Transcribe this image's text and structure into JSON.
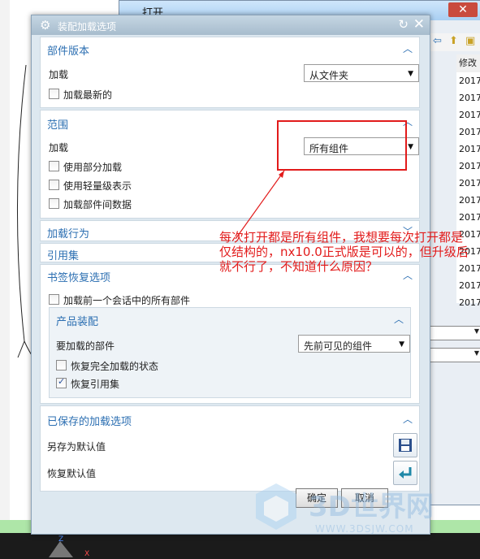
{
  "background": {
    "open_dialog_title": "打开",
    "open_column_header": "修改日",
    "open_dates": [
      "2017",
      "2017",
      "2017",
      "2017",
      "2017",
      "2017",
      "2017",
      "2017",
      "2017",
      "2017",
      "2017",
      "2017",
      "2017",
      "2017"
    ]
  },
  "dialog": {
    "title": "装配加载选项",
    "section_version": {
      "title": "部件版本",
      "load_label": "加载",
      "load_value": "从文件夹",
      "load_latest_label": "加载最新的"
    },
    "section_scope": {
      "title": "范围",
      "load_label": "加载",
      "load_value": "所有组件",
      "cb_partial": "使用部分加载",
      "cb_lightweight": "使用轻量级表示",
      "cb_interpart": "加载部件间数据"
    },
    "section_behavior": {
      "title": "加载行为"
    },
    "section_refset": {
      "title": "引用集"
    },
    "section_bookmark": {
      "title": "书签恢复选项",
      "cb_load_all": "加载前一个会话中的所有部件",
      "product_assembly": {
        "title": "产品装配",
        "parts_label": "要加载的部件",
        "parts_value": "先前可见的组件",
        "cb_restore_state": "恢复完全加载的状态",
        "cb_restore_refset": "恢复引用集"
      }
    },
    "section_saved": {
      "title": "已保存的加载选项",
      "save_default": "另存为默认值",
      "restore_default": "恢复默认值"
    },
    "ok": "确定",
    "cancel": "取消"
  },
  "annotation": "每次打开都是所有组件，我想要每次打开都是仅结构的，nx10.0正式版是可以的，但升级后就不行了，不知道什么原因？",
  "watermark": {
    "name": "3D世界网",
    "url": "WWW.3DSJW.COM"
  },
  "colors": {
    "section_title": "#2c6fb2",
    "annotation": "#e21b1b",
    "dialog_bg": "#dde8f0"
  }
}
